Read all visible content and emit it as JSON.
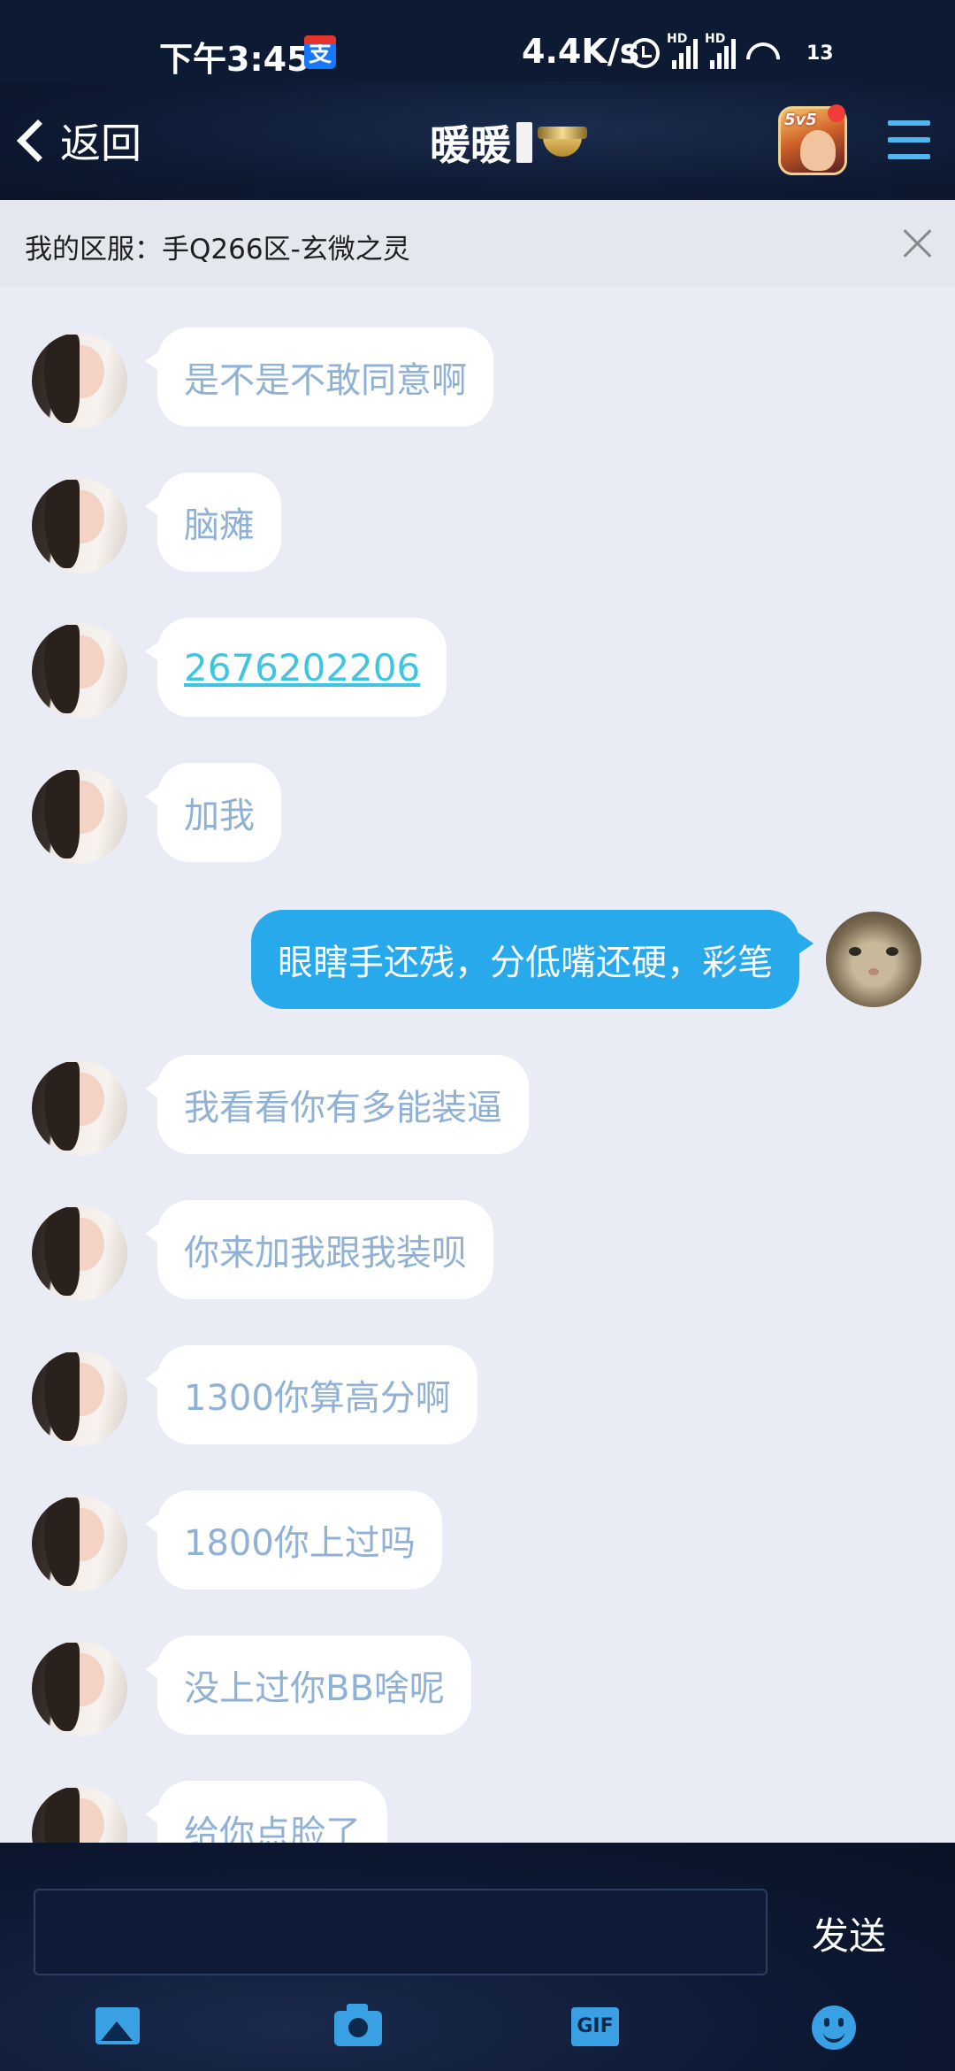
{
  "status_bar": {
    "time": "下午3:45",
    "alipay_glyph": "支",
    "net_speed": "4.4K/s",
    "hd_label_1": "HD",
    "hd_label_2": "HD",
    "battery": "13",
    "icons": [
      "alipay-icon",
      "alarm-icon",
      "signal-icon",
      "signal-icon",
      "wifi-icon",
      "battery-icon"
    ]
  },
  "header": {
    "back_label": "返回",
    "title": "暖暖",
    "game_icon_text": "5v5",
    "accent_color": "#4fb6ef"
  },
  "server_notice": {
    "text": "我的区服：手Q266区-玄微之灵"
  },
  "messages": [
    {
      "side": "left",
      "text": "是不是不敢同意啊"
    },
    {
      "side": "left",
      "text": "脑瘫"
    },
    {
      "side": "left",
      "text": "2676202206",
      "is_link": true
    },
    {
      "side": "left",
      "text": "加我"
    },
    {
      "side": "right",
      "text": "眼瞎手还残，分低嘴还硬，彩笔"
    },
    {
      "side": "left",
      "text": "我看看你有多能装逼"
    },
    {
      "side": "left",
      "text": "你来加我跟我装呗"
    },
    {
      "side": "left",
      "text": "1300你算高分啊"
    },
    {
      "side": "left",
      "text": "1800你上过吗"
    },
    {
      "side": "left",
      "text": "没上过你BB啥呢"
    },
    {
      "side": "left",
      "text": "给你点脸了"
    }
  ],
  "composer": {
    "input_value": "",
    "send_label": "发送",
    "gif_label": "GIF",
    "tools": [
      "image-icon",
      "camera-icon",
      "gif-icon",
      "emoji-icon"
    ]
  },
  "colors": {
    "own_bubble": "#27a9ec",
    "other_bubble": "#ffffff",
    "other_text": "#8fb1d6",
    "link": "#3ec6e0"
  }
}
